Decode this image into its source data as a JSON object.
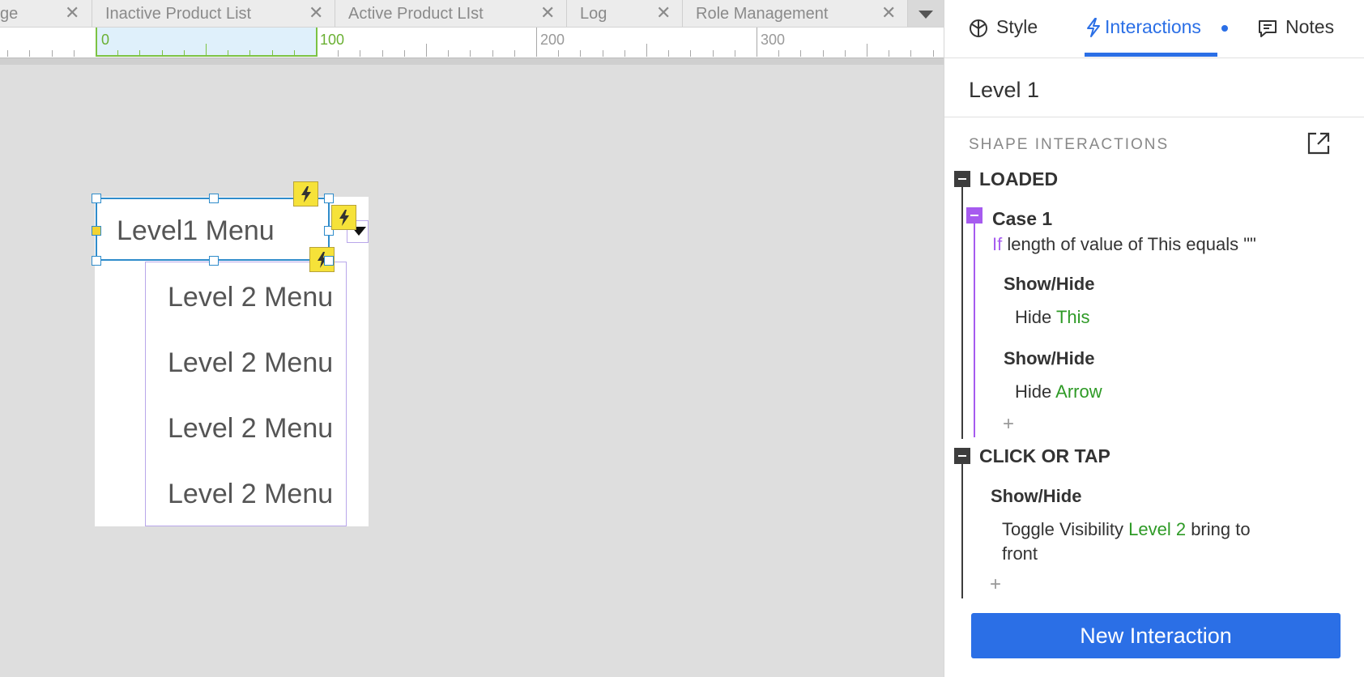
{
  "document_tabs": [
    {
      "label": "ge"
    },
    {
      "label": "Inactive Product List"
    },
    {
      "label": "Active Product LIst"
    },
    {
      "label": "Log"
    },
    {
      "label": "Role Management"
    }
  ],
  "tab_close_glyph": "✕",
  "ruler": {
    "labels": [
      "0",
      "100",
      "200",
      "300"
    ]
  },
  "canvas": {
    "level1_text": "Level1 Menu",
    "level2_items": [
      "Level 2 Menu",
      "Level 2 Menu",
      "Level 2 Menu",
      "Level 2 Menu"
    ]
  },
  "panel": {
    "tabs": {
      "style": "Style",
      "interactions": "Interactions",
      "notes": "Notes"
    },
    "widget_name": "Level 1",
    "section_title": "SHAPE INTERACTIONS",
    "events": {
      "loaded": {
        "label": "LOADED",
        "case": {
          "label": "Case 1",
          "cond_kw": "If",
          "cond_text": " length of value of This equals \"\""
        },
        "actions": [
          {
            "title": "Show/Hide",
            "verb": "Hide ",
            "target": "This"
          },
          {
            "title": "Show/Hide",
            "verb": "Hide ",
            "target": "Arrow"
          }
        ]
      },
      "click": {
        "label": "CLICK OR TAP",
        "action": {
          "title": "Show/Hide",
          "verb": "Toggle Visibility ",
          "target": "Level 2",
          "suffix": "  bring to",
          "suffix2": "front"
        }
      }
    },
    "plus_glyph": "+",
    "new_interaction_label": "New Interaction"
  },
  "colors": {
    "accent": "#2b6fe6",
    "case": "#a65bef",
    "target": "#2e9a26",
    "selection": "#2f8ccb",
    "interaction_badge": "#f6e239"
  },
  "icons": [
    "style-icon",
    "lightning-icon",
    "notes-icon",
    "popout-icon",
    "close-icon",
    "chevron-down-icon"
  ]
}
